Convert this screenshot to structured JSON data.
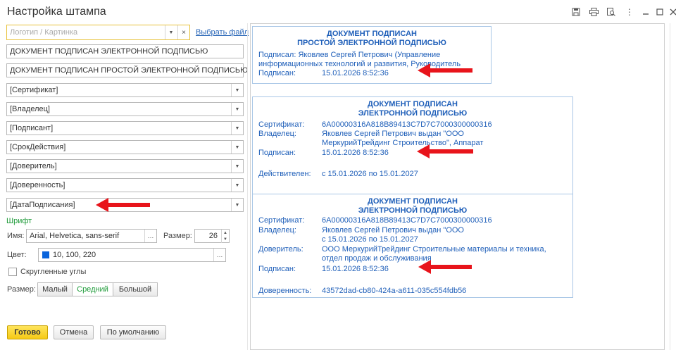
{
  "window": {
    "title": "Настройка штампа"
  },
  "logo": {
    "placeholder": "Логотип / Картинка",
    "choose_file": "Выбрать файл"
  },
  "fields": [
    "ДОКУМЕНТ ПОДПИСАН ЭЛЕКТРОННОЙ ПОДПИСЬЮ",
    "ДОКУМЕНТ ПОДПИСАН ПРОСТОЙ ЭЛЕКТРОННОЙ ПОДПИСЬЮ",
    "[Сертификат]",
    "[Владелец]",
    "[Подписант]",
    "[СрокДействия]",
    "[Доверитель]",
    "[Доверенность]",
    "[ДатаПодписания]"
  ],
  "font": {
    "section": "Шрифт",
    "name_label": "Имя:",
    "name_value": "Arial, Helvetica, sans-serif",
    "size_label": "Размер:",
    "size_value": "26",
    "color_label": "Цвет:",
    "color_value": "10, 100, 220",
    "color_hex": "#0a64dc"
  },
  "rounded": {
    "label": "Скругленные углы"
  },
  "size_group": {
    "label": "Размер:",
    "options": [
      "Малый",
      "Средний",
      "Большой"
    ],
    "selected": "Средний"
  },
  "buttons": {
    "ok": "Готово",
    "cancel": "Отмена",
    "default": "По умолчанию"
  },
  "stamps": {
    "simple": {
      "title1": "ДОКУМЕНТ ПОДПИСАН",
      "title2": "ПРОСТОЙ ЭЛЕКТРОННОЙ ПОДПИСЬЮ",
      "signer_line1": "Подписал: Яковлев Сергей Петрович (Управление",
      "signer_line2": "информационных технологий и развития, Руководитель",
      "signed_label": "Подписан:",
      "signed_value": "15.01.2026 8:52:36"
    },
    "eds": {
      "title1": "ДОКУМЕНТ ПОДПИСАН",
      "title2": "ЭЛЕКТРОННОЙ ПОДПИСЬЮ",
      "cert_label": "Сертификат:",
      "cert_value": "6A00000316A818B89413C7D7C7000300000316",
      "owner_label": "Владелец:",
      "owner_line1": "Яковлев Сергей Петрович выдан \"ООО",
      "owner_line2": "МеркурийТрейдинг Строительство\", Аппарат",
      "signed_label": "Подписан:",
      "signed_value": "15.01.2026 8:52:36",
      "valid_label": "Действителен:",
      "valid_value": "с 15.01.2026 по 15.01.2027"
    },
    "proxy": {
      "title1": "ДОКУМЕНТ ПОДПИСАН",
      "title2": "ЭЛЕКТРОННОЙ ПОДПИСЬЮ",
      "cert_label": "Сертификат:",
      "cert_value": "6A00000316A818B89413C7D7C7000300000316",
      "owner_label": "Владелец:",
      "owner_line1": "Яковлев Сергей Петрович выдан \"ООО",
      "owner_line2": "с 15.01.2026 по 15.01.2027",
      "principal_label": "Доверитель:",
      "principal_line1": "ООО МеркурийТрейдинг Строительные материалы и техника,",
      "principal_line2": "отдел продаж и обслуживания",
      "signed_label": "Подписан:",
      "signed_value": "15.01.2026 8:52:36",
      "poa_label": "Доверенность:",
      "poa_value": "43572dad-cb80-424a-a611-035c554fdb56"
    }
  },
  "colors": {
    "arrow": "#e8141b",
    "accent_green": "#1f9b3a",
    "link": "#2a67b8",
    "stamp_text": "#1f5fb9",
    "primary_button": "#f5c915"
  }
}
